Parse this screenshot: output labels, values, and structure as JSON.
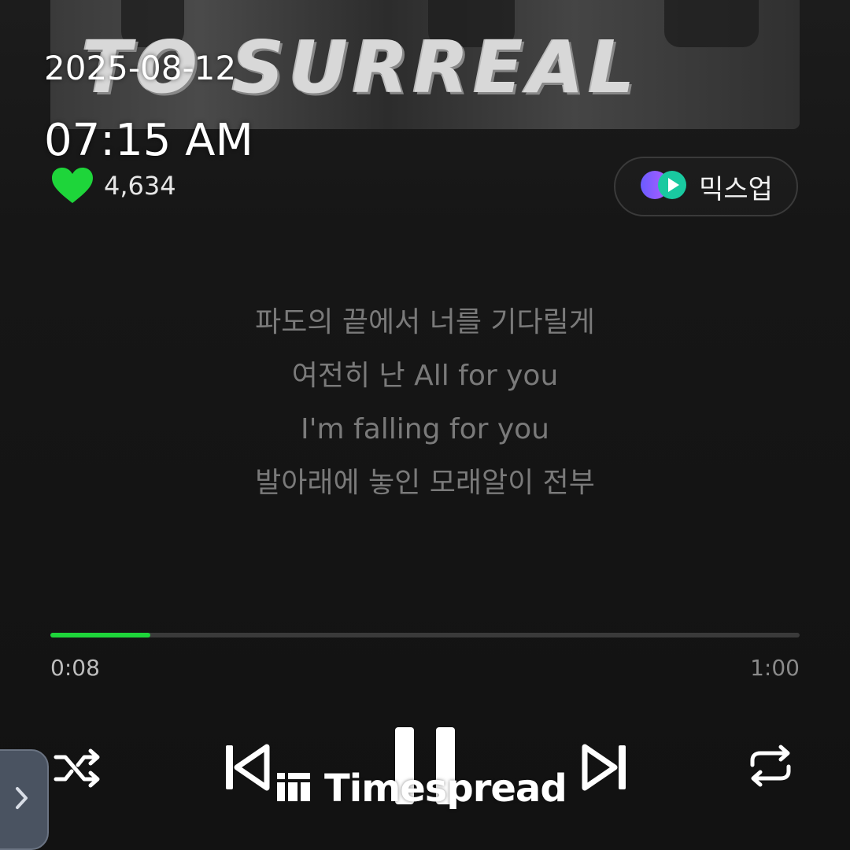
{
  "album": {
    "title_art": "TO SURREAL"
  },
  "overlay": {
    "date": "2025-08-12",
    "time": "07:15 AM"
  },
  "likes": {
    "icon": "heart-icon",
    "count": "4,634",
    "color": "#1ed53a"
  },
  "mixup": {
    "label": "믹스업",
    "icon": "mixup-icon"
  },
  "lyrics": [
    "파도의 끝에서 너를 기다릴게",
    "여전히 난 All for you",
    "I'm falling for you",
    "발아래에 놓인 모래알이 전부"
  ],
  "progress": {
    "elapsed": "0:08",
    "total": "1:00",
    "fraction": 0.1333,
    "accent": "#1ed53a"
  },
  "controls": {
    "shuffle": "shuffle-icon",
    "previous": "previous-icon",
    "pause": "pause-icon",
    "next": "next-icon",
    "repeat": "repeat-icon"
  },
  "watermark": {
    "text": "Timespread"
  },
  "side_tab": {
    "icon": "chevron-right-icon"
  }
}
